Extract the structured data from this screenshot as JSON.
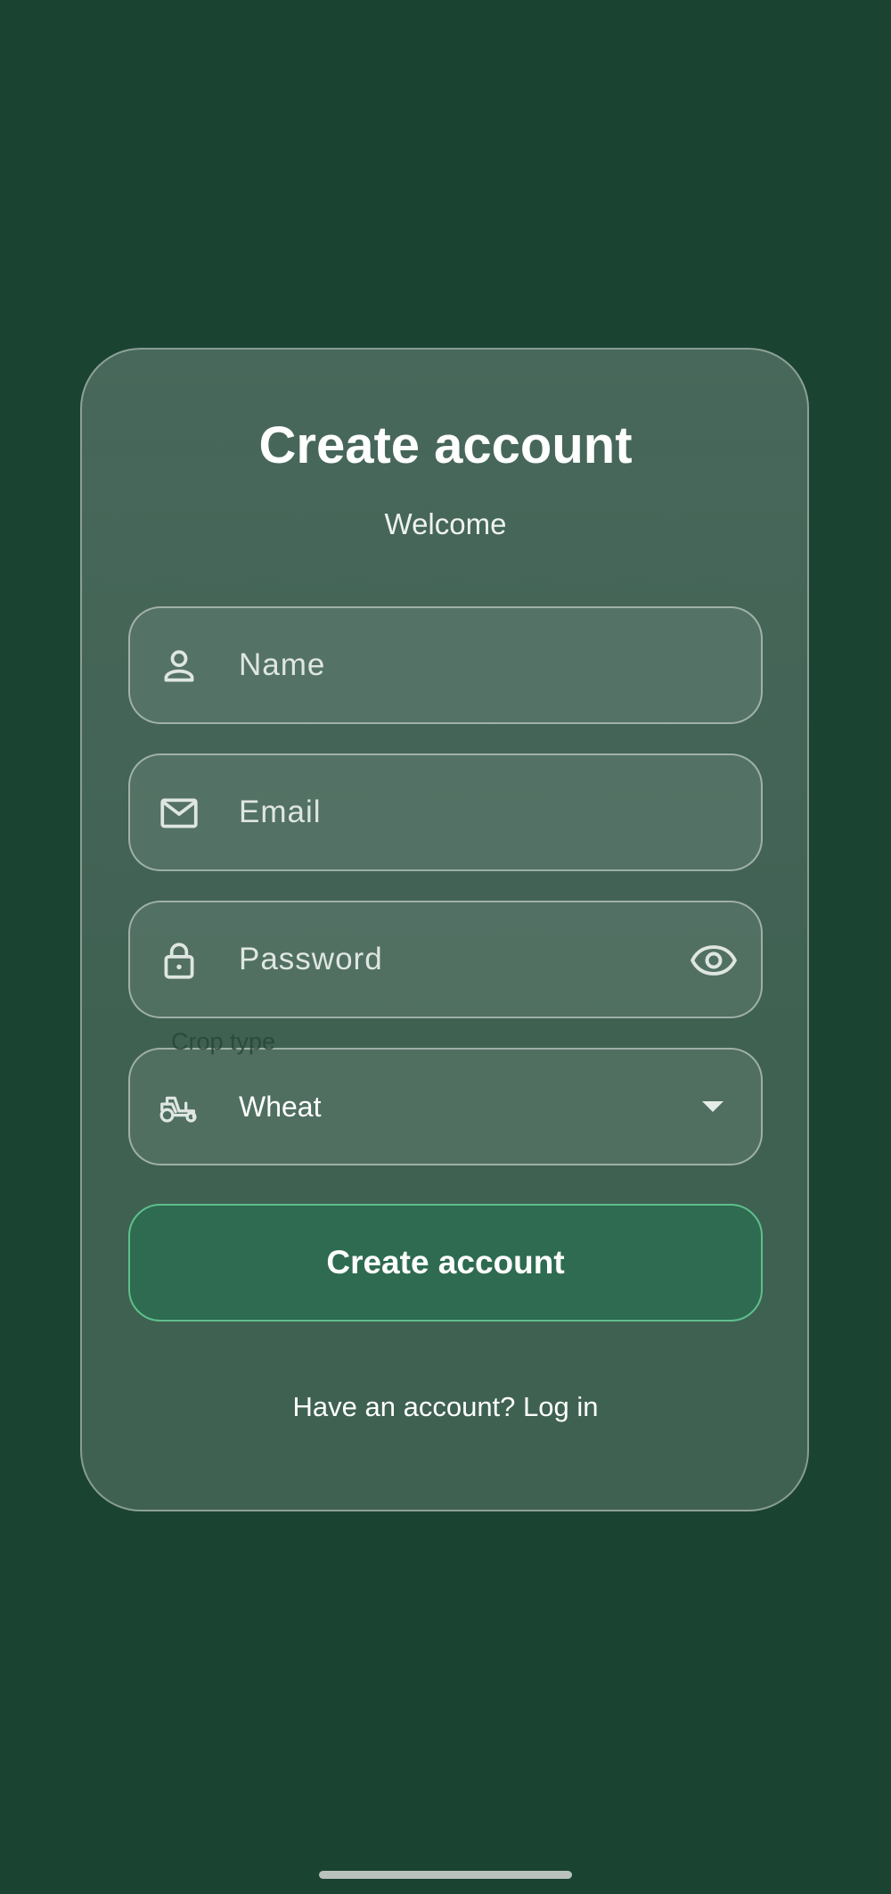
{
  "signup": {
    "title": "Create account",
    "subtitle": "Welcome",
    "name_placeholder": "Name",
    "email_placeholder": "Email",
    "password_placeholder": "Password",
    "crop_label": "Crop type",
    "crop_value": "Wheat",
    "submit_label": "Create account",
    "login_link": "Have an account? Log in"
  },
  "icons": {
    "name": "person-icon",
    "email": "mail-icon",
    "password": "lock-icon",
    "visibility": "eye-icon",
    "crop": "tractor-icon",
    "dropdown": "dropdown-arrow-icon"
  },
  "colors": {
    "background": "#1b4332",
    "button": "#2e6b50",
    "button_border": "#5fbf8c"
  }
}
